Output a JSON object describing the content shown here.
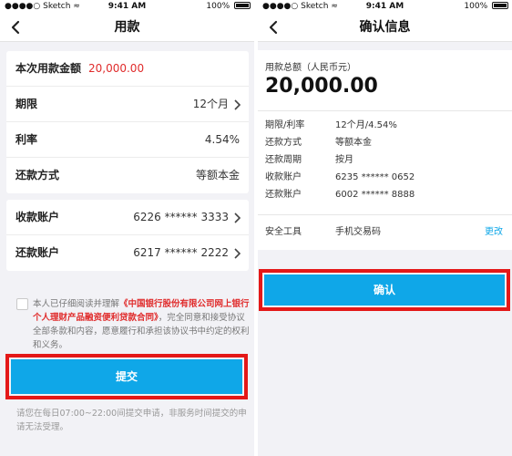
{
  "status_bar": {
    "carrier": "Sketch",
    "time": "9:41 AM",
    "battery": "100%"
  },
  "left": {
    "title": "用款",
    "card1": {
      "amount_label": "本次用款金额",
      "amount_value": "20,000.00",
      "term_label": "期限",
      "term_value": "12个月",
      "rate_label": "利率",
      "rate_value": "4.54%",
      "method_label": "还款方式",
      "method_value": "等额本金"
    },
    "card2": {
      "receive_label": "收款账户",
      "receive_value": "6226 ****** 3333",
      "repay_label": "还款账户",
      "repay_value": "6217 ****** 2222"
    },
    "agreement": {
      "prefix": "本人已仔细阅读并理解",
      "contract": "《中国银行股份有限公司网上银行个人理财产品融资便利贷款合同》",
      "suffix": "，完全同意和接受协议全部条款和内容，愿意履行和承担该协议书中约定的权利和义务。"
    },
    "submit_label": "提交",
    "note": "请您在每日07:00~22:00间提交申请，非服务时间提交的申请无法受理。"
  },
  "right": {
    "title": "确认信息",
    "total_label": "用款总额（人民币元）",
    "total_value": "20,000.00",
    "rows": [
      {
        "key": "期限/利率",
        "value": "12个月/4.54%"
      },
      {
        "key": "还款方式",
        "value": "等额本金"
      },
      {
        "key": "还款周期",
        "value": "按月"
      },
      {
        "key": "收款账户",
        "value": "6235 ****** 0652"
      },
      {
        "key": "还款账户",
        "value": "6002 ****** 8888"
      }
    ],
    "security": {
      "key": "安全工具",
      "value": "手机交易码",
      "action": "更改"
    },
    "confirm_label": "确认"
  },
  "colors": {
    "accent": "#0fa7e8",
    "highlight": "#e41818",
    "amount": "#e02b2b"
  },
  "icons": [
    "back-arrow-icon",
    "chevron-right-icon",
    "wifi-icon",
    "signal-dots-icon",
    "battery-icon"
  ]
}
